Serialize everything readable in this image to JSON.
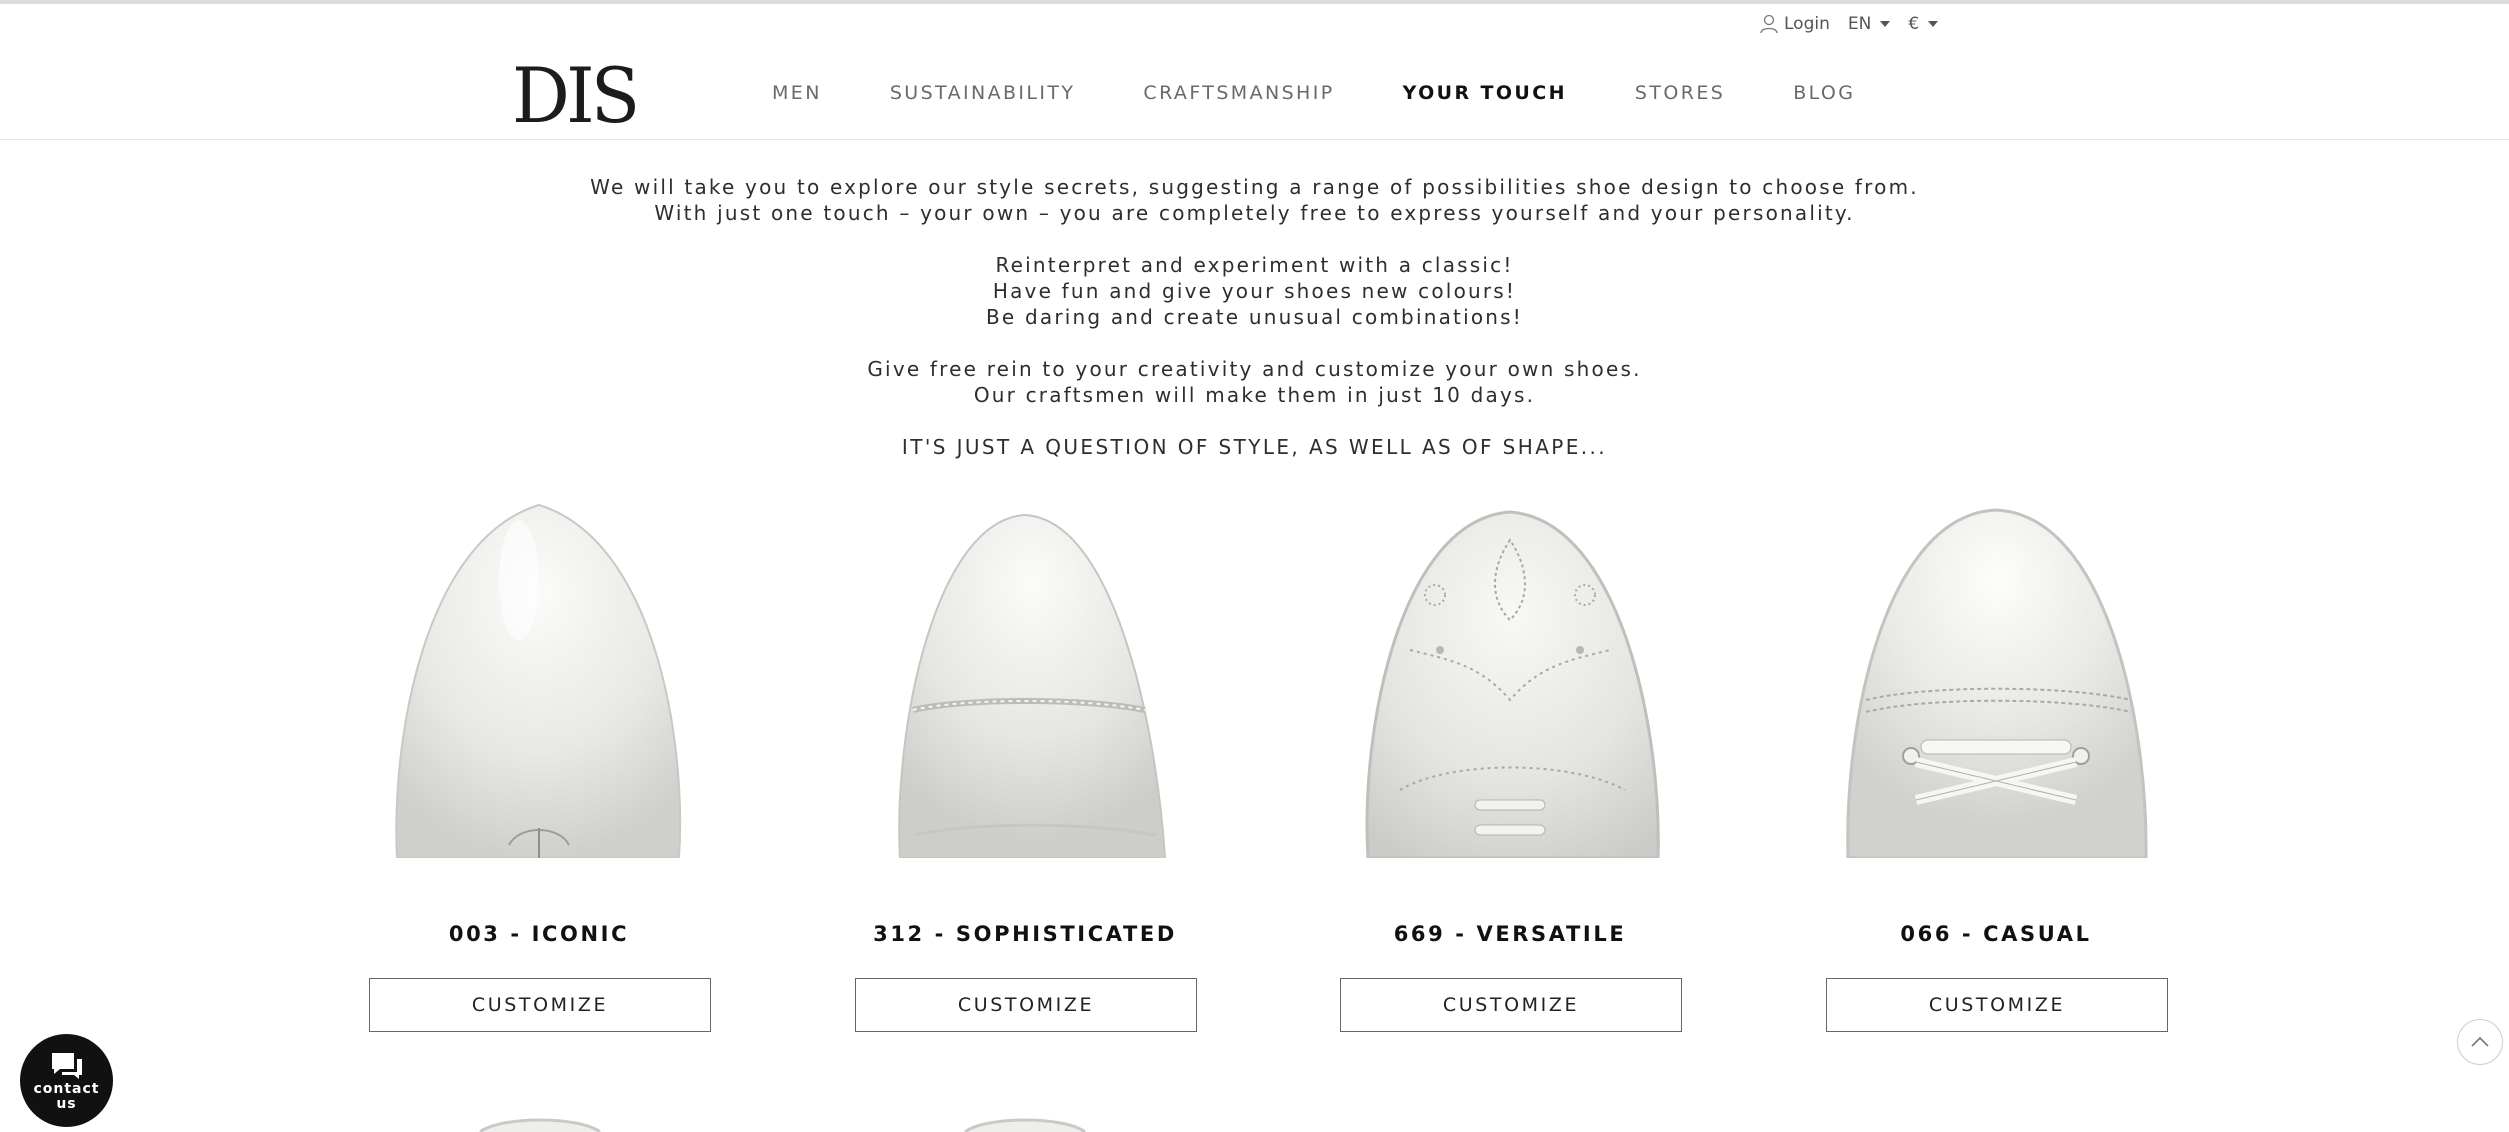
{
  "utility": {
    "login_label": "Login",
    "language": "EN",
    "currency": "€"
  },
  "brand": {
    "logo_text": "DIS"
  },
  "nav": {
    "items": [
      {
        "label": "MEN",
        "active": false
      },
      {
        "label": "SUSTAINABILITY",
        "active": false
      },
      {
        "label": "CRAFTSMANSHIP",
        "active": false
      },
      {
        "label": "YOUR TOUCH",
        "active": true
      },
      {
        "label": "STORES",
        "active": false
      },
      {
        "label": "BLOG",
        "active": false
      }
    ]
  },
  "intro": {
    "lines_1": [
      "We will take you to explore our style secrets, suggesting a range of possibilities shoe design to choose from.",
      "With just one touch – your own – you are completely free to express yourself and your personality."
    ],
    "lines_2": [
      "Reinterpret and experiment with a classic!",
      "Have fun and give your shoes new colours!",
      "Be daring and create unusual combinations!"
    ],
    "lines_3": [
      "Give free rein to your creativity and customize your own shoes.",
      "Our craftsmen will make them in just 10 days."
    ],
    "tagline": "IT'S JUST A QUESTION OF STYLE, AS WELL AS OF SHAPE..."
  },
  "products": [
    {
      "title": "003 - ICONIC",
      "button": "CUSTOMIZE",
      "style": "plain"
    },
    {
      "title": "312 - SOPHISTICATED",
      "button": "CUSTOMIZE",
      "style": "captoe"
    },
    {
      "title": "669 - VERSATILE",
      "button": "CUSTOMIZE",
      "style": "brogue"
    },
    {
      "title": "066 - CASUAL",
      "button": "CUSTOMIZE",
      "style": "sneaker"
    }
  ],
  "contact": {
    "label_line1": "contact",
    "label_line2": "us"
  },
  "colors": {
    "accent": "#111111",
    "text": "#222222",
    "muted": "#6a6a6a",
    "shoe": "#e9e9e6"
  }
}
